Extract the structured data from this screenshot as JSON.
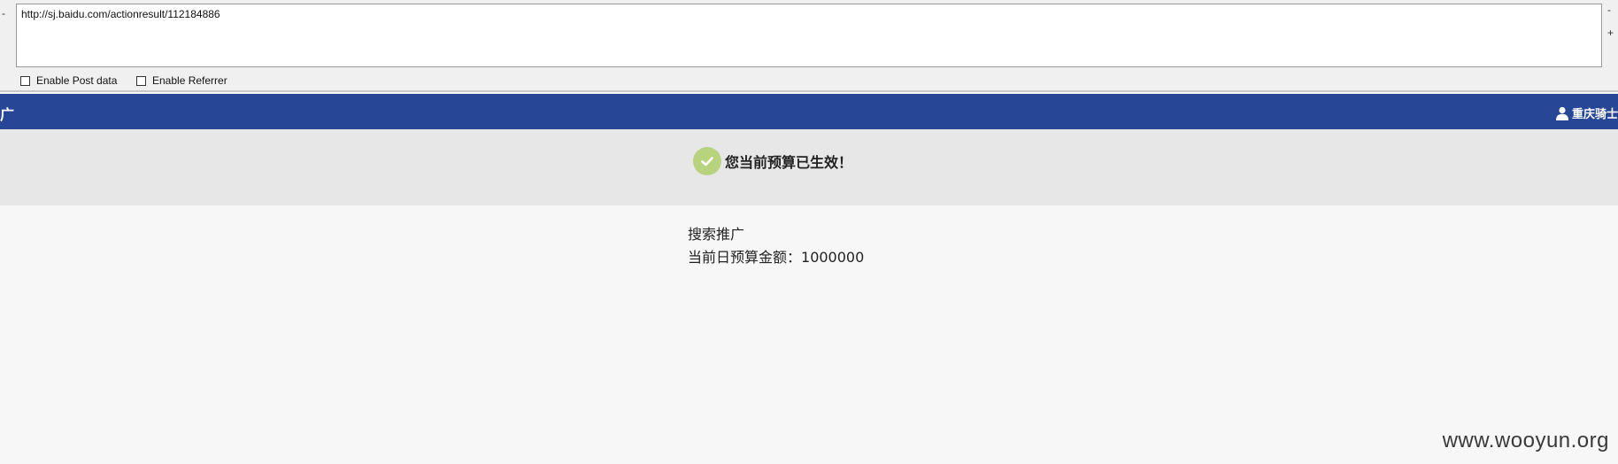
{
  "toolbar": {
    "url": "http://sj.baidu.com/actionresult/112184886",
    "left_glyph": "-",
    "right_glyph_top": "-",
    "right_glyph_bottom": "+",
    "options": [
      {
        "label": "Enable Post data",
        "checked": false
      },
      {
        "label": "Enable Referrer",
        "checked": false
      }
    ]
  },
  "header": {
    "brand": "广",
    "user_name": "重庆骑士",
    "accent_color": "#274796"
  },
  "banner": {
    "message": "您当前预算已生效！",
    "icon": "check-icon",
    "icon_color": "#b9d27d"
  },
  "content": {
    "line1": "搜索推广",
    "budget_label": "当前日预算金额：",
    "budget_value": "1000000"
  },
  "watermark": "www.wooyun.org"
}
